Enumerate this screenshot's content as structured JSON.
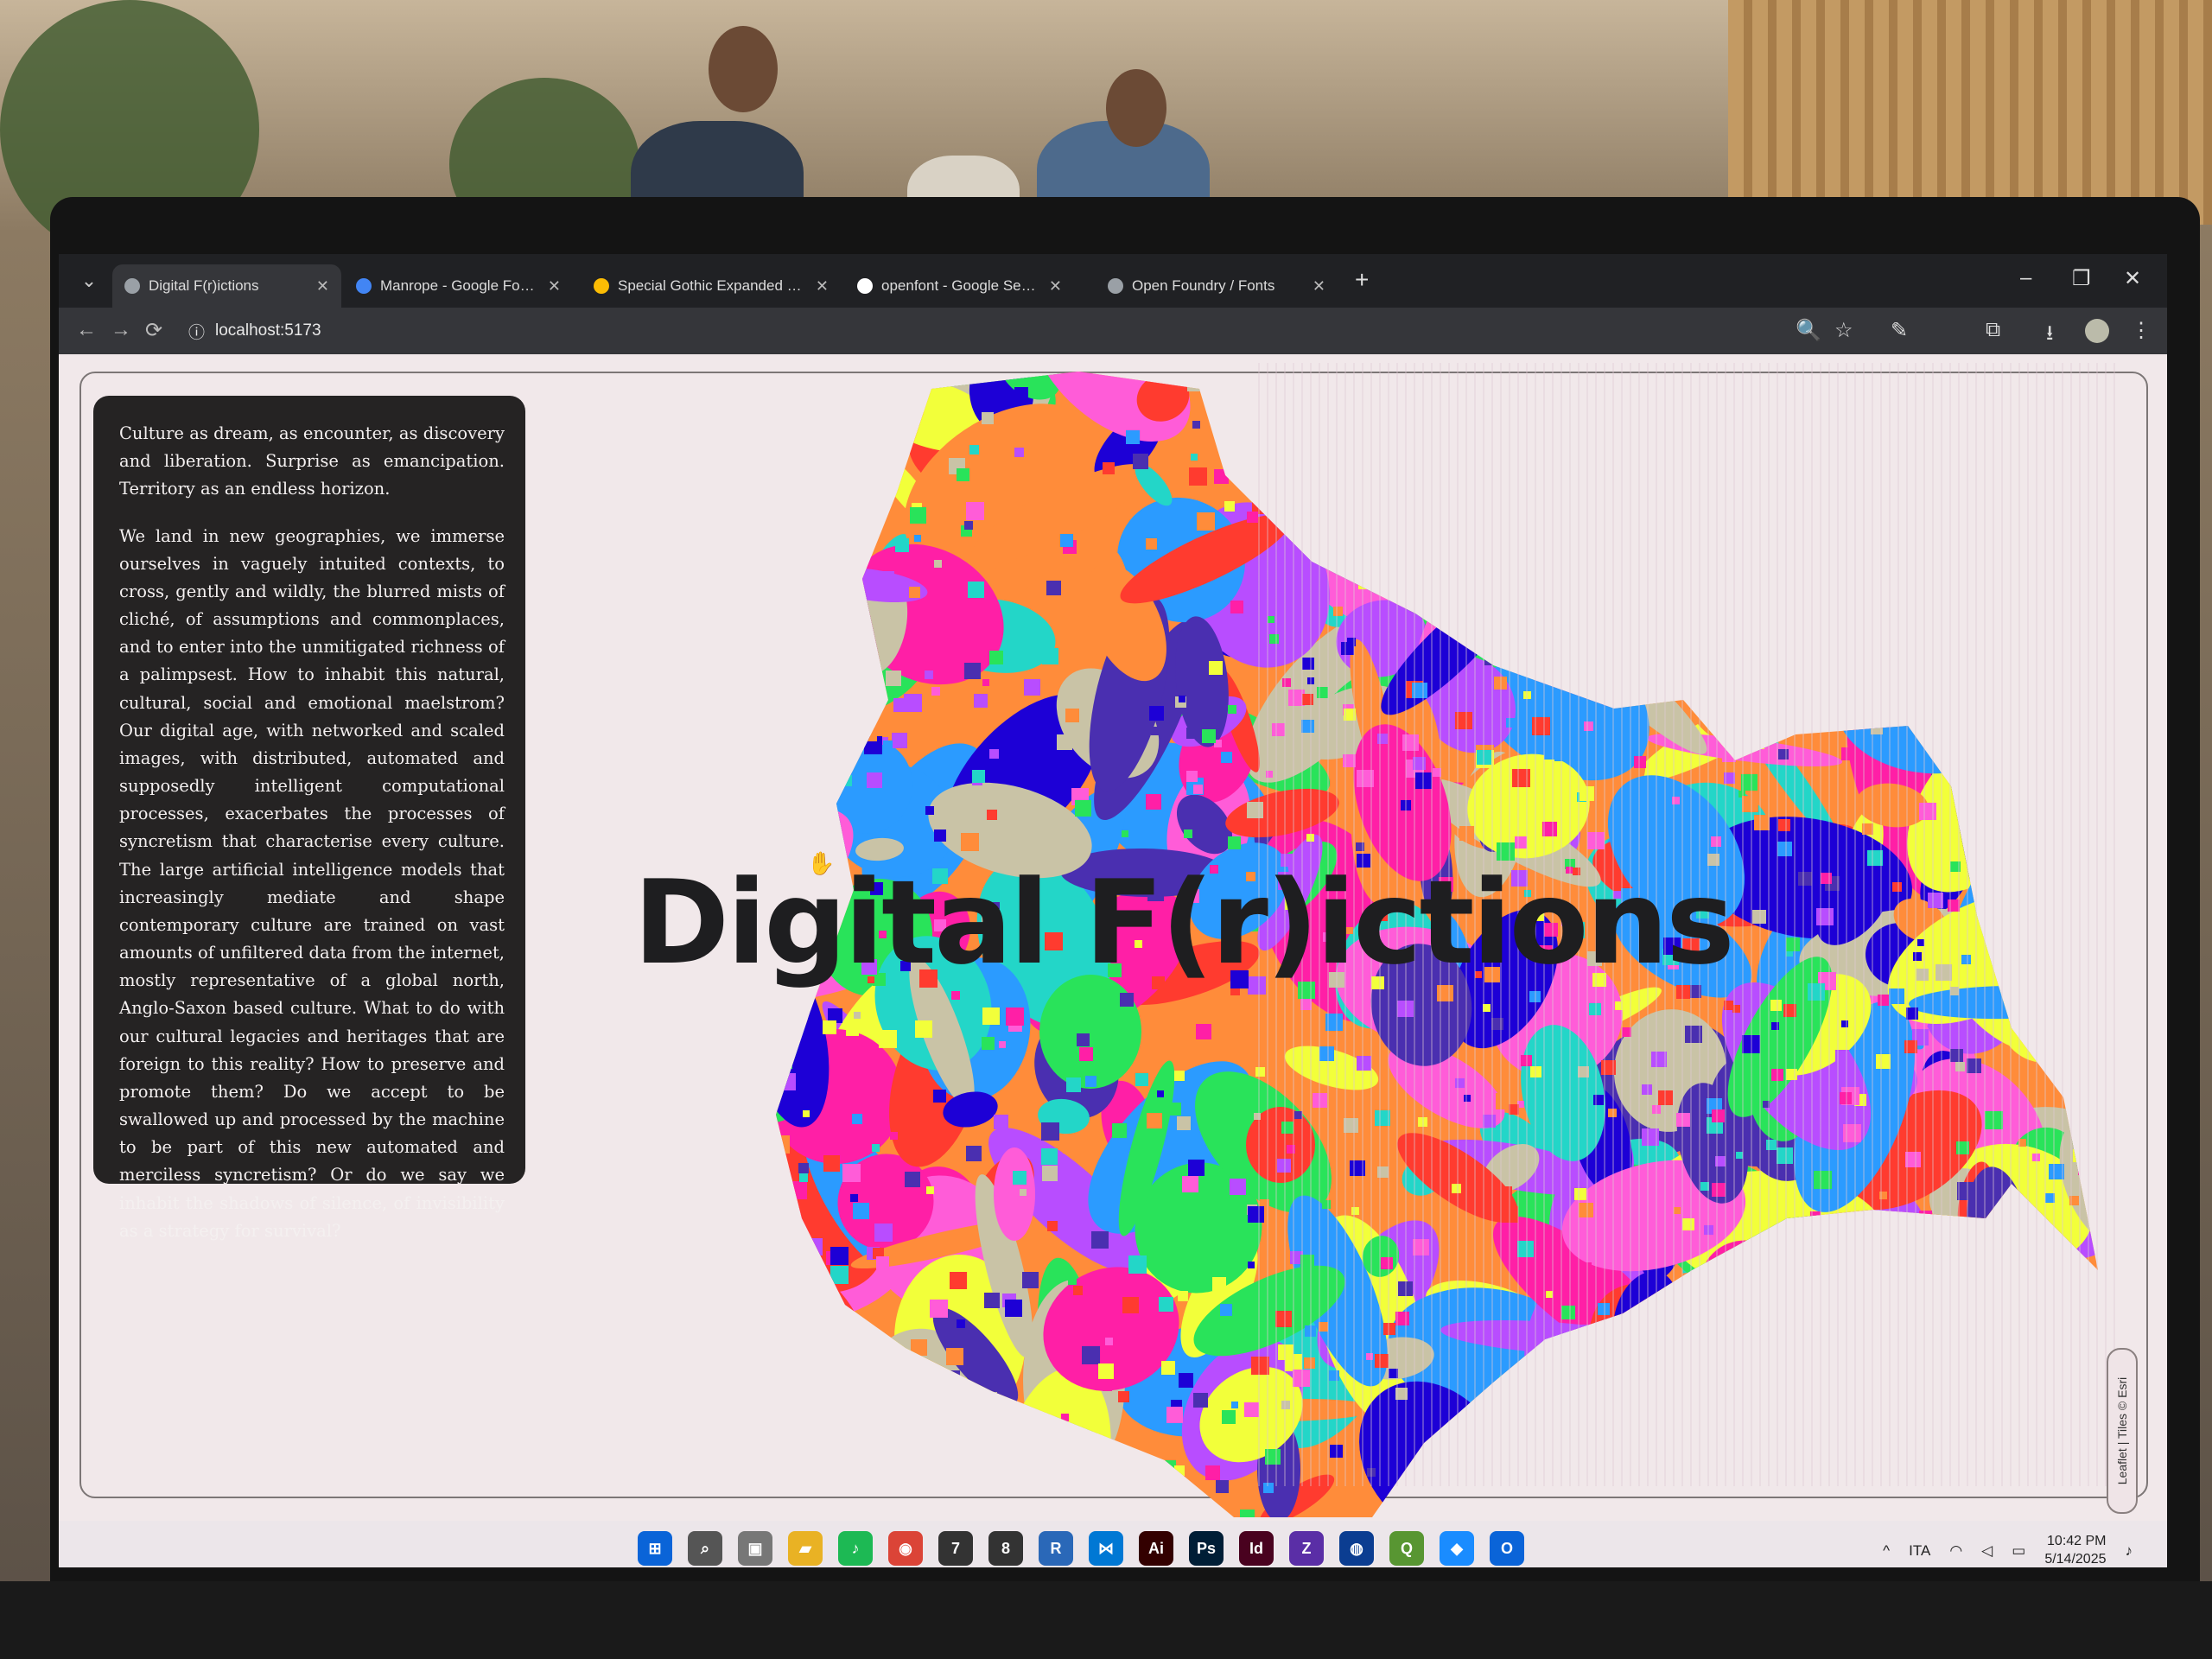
{
  "browser": {
    "tabs": [
      {
        "label": "Digital F(r)ictions",
        "active": true,
        "favicon_color": "#9aa0a6"
      },
      {
        "label": "Manrope - Google Fonts",
        "active": false,
        "favicon_color": "#4285f4"
      },
      {
        "label": "Special Gothic Expanded One",
        "active": false,
        "favicon_color": "#fbbc04"
      },
      {
        "label": "openfont - Google Search",
        "active": false,
        "favicon_color": "#ffffff"
      },
      {
        "label": "Open Foundry / Fonts",
        "active": false,
        "favicon_color": "#9aa0a6"
      }
    ],
    "address": "localhost:5173",
    "new_tab": "+",
    "window_controls": {
      "minimize": "–",
      "restore": "❐",
      "close": "✕"
    },
    "nav_icons": {
      "back": "←",
      "forward": "→",
      "reload": "⟳",
      "site_info": "ⓘ"
    },
    "toolbar_icons": {
      "zoom": "🔍",
      "bookmark": "☆",
      "eyedropper": "✎",
      "extensions": "⧉",
      "download": "⭳",
      "menu": "⋮"
    }
  },
  "page": {
    "title": "Digital F(r)ictions",
    "intro_paragraphs": [
      "Culture as dream, as encounter, as discovery and liberation. Surprise as emancipation. Territory as an endless horizon.",
      "We land in new geographies, we immerse ourselves in vaguely intuited contexts, to cross, gently and wildly, the blurred mists of cliché, of assumptions and commonplaces, and to enter into the unmitigated richness of a palimpsest. How to inhabit this natural, cultural, social and emotional maelstrom? Our digital age, with networked and scaled images, with distributed, automated and supposedly intelligent computational processes, exacerbates the processes of syncretism that characterise every culture. The large artificial intelligence models that increasingly mediate and shape contemporary culture are trained on vast amounts of unfiltered data from the internet, mostly representative of a global north, Anglo-Saxon based culture. What to do with our cultural legacies and heritages that are foreign to this reality? How to preserve and promote them? Do we accept to be swallowed up and processed by the machine to be part of this new automated and merciless syncretism? Or do we say we inhabit the shadows of silence, of invisibility as a strategy for survival?"
    ],
    "map_attribution": "Leaflet | Tiles © Esri",
    "map_colors": [
      "#ff1fa6",
      "#1d00d6",
      "#ff8c3a",
      "#29e35a",
      "#b84dff",
      "#ff3b2f",
      "#23d6c8",
      "#f2ff3a",
      "#ff5cd8",
      "#2b9bff",
      "#c9c3a6",
      "#4a2fb0"
    ]
  },
  "taskbar": {
    "apps": [
      {
        "name": "start",
        "glyph": "⊞",
        "color": "#0a64d8"
      },
      {
        "name": "search",
        "glyph": "⌕",
        "color": "#555555"
      },
      {
        "name": "task-view",
        "glyph": "▣",
        "color": "#777777"
      },
      {
        "name": "file-explorer",
        "glyph": "▰",
        "color": "#e9b224"
      },
      {
        "name": "spotify",
        "glyph": "♪",
        "color": "#1db954"
      },
      {
        "name": "chrome",
        "glyph": "◉",
        "color": "#db4437"
      },
      {
        "name": "inkscape-7",
        "glyph": "7",
        "color": "#333333"
      },
      {
        "name": "inkscape-8",
        "glyph": "8",
        "color": "#333333"
      },
      {
        "name": "r",
        "glyph": "R",
        "color": "#2a68b8"
      },
      {
        "name": "vscode",
        "glyph": "⋈",
        "color": "#0078d4"
      },
      {
        "name": "illustrator",
        "glyph": "Ai",
        "color": "#330000"
      },
      {
        "name": "photoshop",
        "glyph": "Ps",
        "color": "#001e36"
      },
      {
        "name": "indesign",
        "glyph": "Id",
        "color": "#49021f"
      },
      {
        "name": "app-z",
        "glyph": "Z",
        "color": "#5a2ea6"
      },
      {
        "name": "app-globe",
        "glyph": "◍",
        "color": "#0b3d91"
      },
      {
        "name": "qgis",
        "glyph": "Q",
        "color": "#589632"
      },
      {
        "name": "app-bird",
        "glyph": "◆",
        "color": "#1a8cff"
      },
      {
        "name": "outlook",
        "glyph": "O",
        "color": "#0a64d8"
      }
    ],
    "language": "ITA",
    "time": "10:42 PM",
    "date": "5/14/2025",
    "tray_icons": {
      "chevron": "^",
      "wifi": "◠",
      "volume": "◁",
      "battery": "▭",
      "notifications": "♪"
    }
  }
}
